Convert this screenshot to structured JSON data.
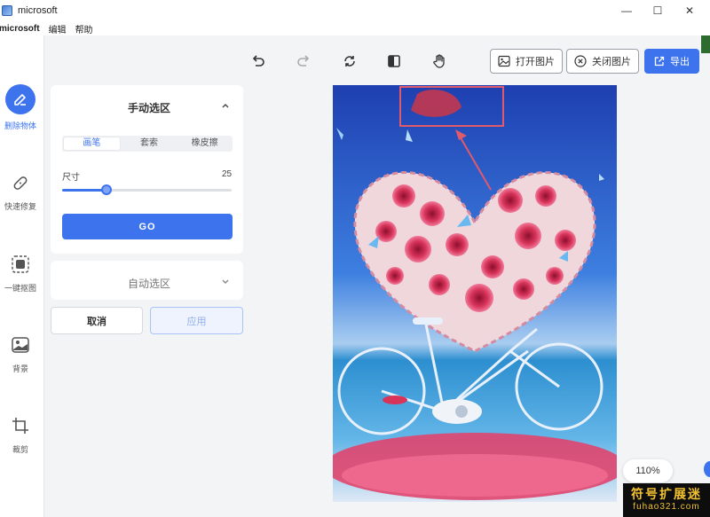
{
  "window": {
    "title": "microsoft",
    "minimize": "—",
    "maximize": "☐",
    "close": "✕"
  },
  "menu": {
    "items": [
      "microsoft",
      "编辑",
      "帮助"
    ]
  },
  "sidebar": {
    "items": [
      {
        "label": "删除物体",
        "icon": "eraser-icon",
        "active": true
      },
      {
        "label": "快速修复",
        "icon": "bandage-icon",
        "active": false
      },
      {
        "label": "一键抠图",
        "icon": "cutout-icon",
        "active": false
      },
      {
        "label": "背景",
        "icon": "image-background-icon",
        "active": false
      },
      {
        "label": "裁剪",
        "icon": "crop-icon",
        "active": false
      }
    ]
  },
  "toolbar": {
    "open_image": "打开图片",
    "close_image": "关闭图片",
    "export": "导出"
  },
  "manual_select": {
    "title": "手动选区",
    "tabs": [
      "画笔",
      "套索",
      "橡皮擦"
    ],
    "active_tab": 0,
    "size_label": "尺寸",
    "size_value": "25",
    "size_fraction": 0.26,
    "go_label": "GO"
  },
  "auto_select": {
    "title": "自动选区"
  },
  "actions": {
    "cancel": "取消",
    "apply": "应用"
  },
  "zoom": {
    "value": "110%"
  },
  "watermark": {
    "line1": "符号扩展迷",
    "line2": "fuhao321.com"
  },
  "colors": {
    "accent": "#3d74ee",
    "selection_box": "#e05a6c"
  }
}
